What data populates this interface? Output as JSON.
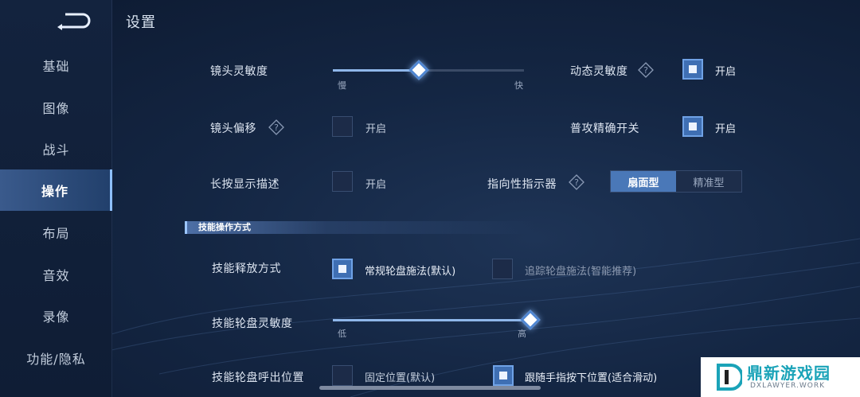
{
  "page_title": "设置",
  "sidebar": {
    "items": [
      {
        "label": "基础"
      },
      {
        "label": "图像"
      },
      {
        "label": "战斗"
      },
      {
        "label": "操作",
        "active": true
      },
      {
        "label": "布局"
      },
      {
        "label": "音效"
      },
      {
        "label": "录像"
      },
      {
        "label": "功能/隐私"
      }
    ]
  },
  "settings": {
    "camera_sensitivity": {
      "label": "镜头灵敏度",
      "min_label": "慢",
      "max_label": "快",
      "value": 0.45
    },
    "dynamic_sensitivity": {
      "label": "动态灵敏度",
      "checked": true,
      "option": "开启"
    },
    "camera_offset": {
      "label": "镜头偏移",
      "checked": false,
      "option": "开启"
    },
    "precise_attack": {
      "label": "普攻精确开关",
      "checked": true,
      "option": "开启"
    },
    "long_press_desc": {
      "label": "长按显示描述",
      "checked": false,
      "option": "开启"
    },
    "directional_indicator": {
      "label": "指向性指示器",
      "options": [
        "扇面型",
        "精准型"
      ],
      "selected": "扇面型"
    }
  },
  "section": {
    "title": "技能操作方式"
  },
  "skill": {
    "release_mode": {
      "label": "技能释放方式",
      "options": [
        {
          "text": "常规轮盘施法(默认)",
          "checked": true
        },
        {
          "text": "追踪轮盘施法(智能推荐)",
          "checked": false
        }
      ]
    },
    "wheel_sensitivity": {
      "label": "技能轮盘灵敏度",
      "min_label": "低",
      "max_label": "高",
      "value": 1.0
    },
    "wheel_position": {
      "label": "技能轮盘呼出位置",
      "options": [
        {
          "text": "固定位置(默认)",
          "checked": false
        },
        {
          "text": "跟随手指按下位置(适合滑动)",
          "checked": true
        }
      ]
    }
  },
  "watermark": {
    "title": "鼎新游戏园",
    "subtitle": "DXLAWYER.WORK"
  },
  "colors": {
    "accent": "#4f86d2",
    "active_nav": "#2b4a78",
    "background": "#142643"
  }
}
